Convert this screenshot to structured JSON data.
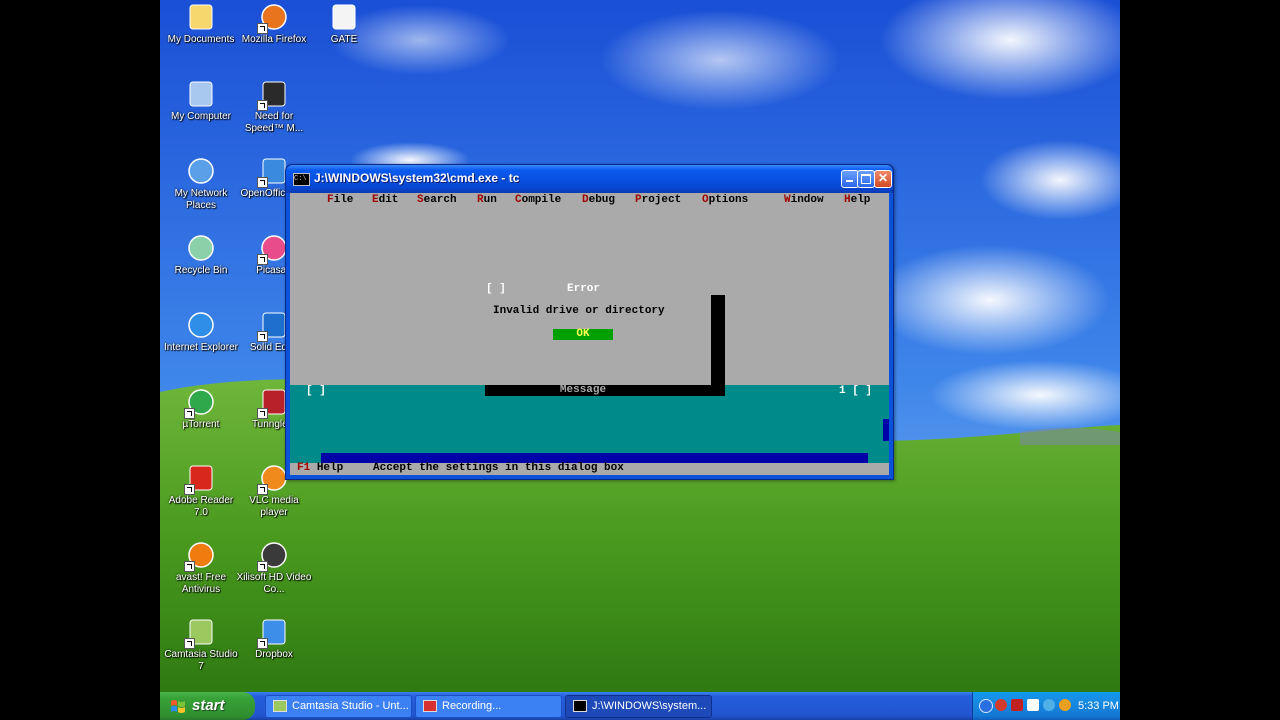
{
  "desktop": {
    "icons": [
      {
        "label": "My Documents",
        "icon": "my-documents-icon",
        "shortcut": false
      },
      {
        "label": "Mozilla Firefox",
        "icon": "firefox-icon",
        "shortcut": true
      },
      {
        "label": "GATE",
        "icon": "text-file-icon",
        "shortcut": false
      },
      {
        "label": "My Computer",
        "icon": "my-computer-icon",
        "shortcut": false
      },
      {
        "label": "Need for Speed™ M...",
        "icon": "nfs-icon",
        "shortcut": true
      },
      {
        "label": "My Network Places",
        "icon": "network-places-icon",
        "shortcut": false
      },
      {
        "label": "OpenOffice 3.3",
        "icon": "openoffice-icon",
        "shortcut": true
      },
      {
        "label": "Recycle Bin",
        "icon": "recycle-bin-icon",
        "shortcut": false
      },
      {
        "label": "Picasa3",
        "icon": "picasa-icon",
        "shortcut": true
      },
      {
        "label": "Internet Explorer",
        "icon": "internet-explorer-icon",
        "shortcut": false
      },
      {
        "label": "Solid Edge",
        "icon": "solid-edge-icon",
        "shortcut": true
      },
      {
        "label": "µTorrent",
        "icon": "utorrent-icon",
        "shortcut": true
      },
      {
        "label": "Tunngle b",
        "icon": "tunngle-icon",
        "shortcut": true
      },
      {
        "label": "Adobe Reader 7.0",
        "icon": "adobe-reader-icon",
        "shortcut": true
      },
      {
        "label": "VLC media player",
        "icon": "vlc-icon",
        "shortcut": true
      },
      {
        "label": "avast! Free Antivirus",
        "icon": "avast-icon",
        "shortcut": true
      },
      {
        "label": "Xilisoft HD Video Co...",
        "icon": "xilisoft-icon",
        "shortcut": true
      },
      {
        "label": "Camtasia Studio 7",
        "icon": "camtasia-icon",
        "shortcut": true
      },
      {
        "label": "Dropbox",
        "icon": "dropbox-icon",
        "shortcut": true
      }
    ]
  },
  "window": {
    "title": "J:\\WINDOWS\\system32\\cmd.exe - tc",
    "icon": "console-icon",
    "icon_text": "C:\\",
    "minimize_glyph": "_",
    "maximize_glyph": "□",
    "close_glyph": "✕"
  },
  "console": {
    "menu": [
      {
        "hotkey": "F",
        "rest": "ile"
      },
      {
        "hotkey": "E",
        "rest": "dit"
      },
      {
        "hotkey": "S",
        "rest": "earch"
      },
      {
        "hotkey": "R",
        "rest": "un"
      },
      {
        "hotkey": "C",
        "rest": "ompile"
      },
      {
        "hotkey": "D",
        "rest": "ebug"
      },
      {
        "hotkey": "P",
        "rest": "roject"
      },
      {
        "hotkey": "O",
        "rest": "ptions"
      },
      {
        "hotkey": "W",
        "rest": "indow"
      },
      {
        "hotkey": "H",
        "rest": "elp"
      }
    ],
    "dialog": {
      "close_box": "[ ]",
      "title": "Error",
      "message": "Invalid drive or directory",
      "ok_label": "OK"
    },
    "message_window": {
      "left_box": "[ ]",
      "title": "Message",
      "right_text": "1 [ ]"
    },
    "statusbar": {
      "key": "F1",
      "key_label": "Help",
      "text": "Accept the settings in this dialog box"
    }
  },
  "taskbar": {
    "start_label": "start",
    "tasks": [
      {
        "label": "Camtasia Studio - Unt...",
        "icon": "camtasia-icon",
        "active": false
      },
      {
        "label": "Recording...",
        "icon": "recording-icon",
        "active": false
      },
      {
        "label": "J:\\WINDOWS\\system...",
        "icon": "console-icon",
        "active": true
      }
    ],
    "tray": {
      "icons": [
        "show-hidden-icon",
        "antivirus-tray-icon",
        "network-tray-icon",
        "volume-icon",
        "messenger-icon",
        "update-icon"
      ],
      "clock": "5:33 PM"
    }
  }
}
